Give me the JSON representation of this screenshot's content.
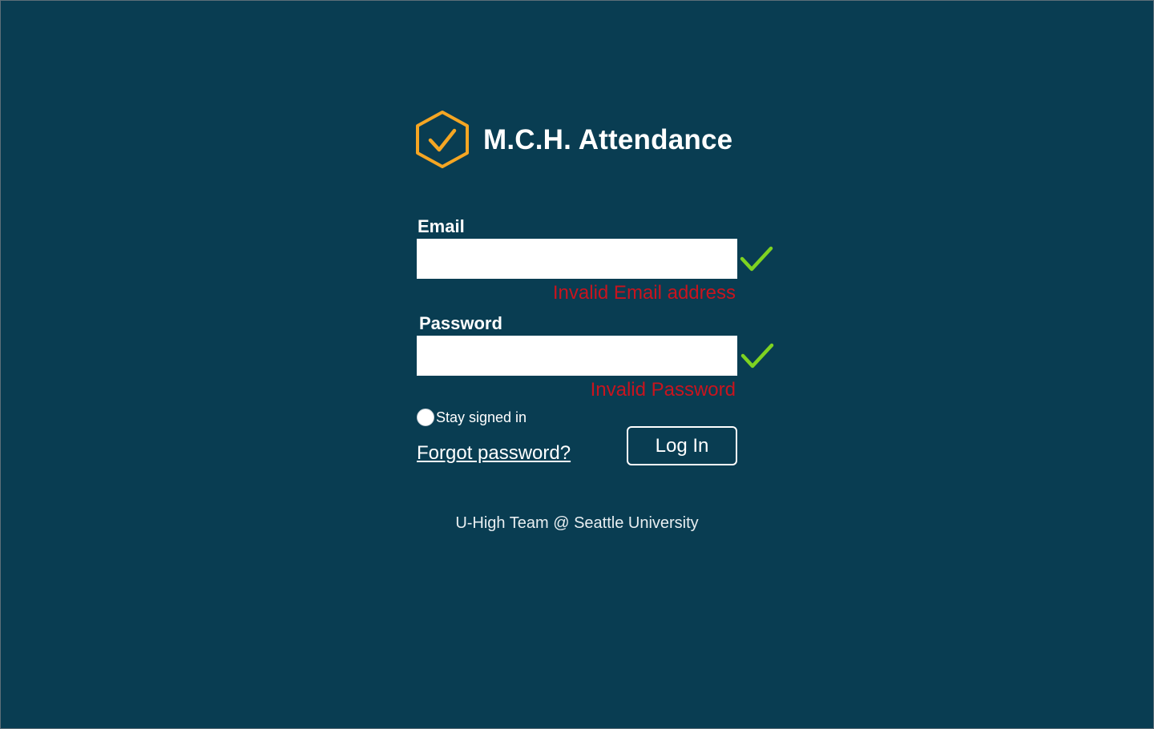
{
  "app": {
    "title": "M.C.H. Attendance",
    "logo_icon": "hexagon-check-icon"
  },
  "colors": {
    "background": "#093d52",
    "logo_orange": "#f5a623",
    "valid_green": "#7ed321",
    "error_red": "#c8141e"
  },
  "form": {
    "email_label": "Email",
    "email_value": "",
    "email_error": "Invalid Email address",
    "email_status_icon": "green-check-icon",
    "password_label": "Password",
    "password_value": "",
    "password_error": "Invalid Password",
    "password_status_icon": "green-check-icon",
    "stay_signed_in_label": "Stay signed in",
    "stay_signed_in_checked": false,
    "forgot_password_label": "Forgot password?",
    "login_button_label": "Log In"
  },
  "footer": {
    "text": "U-High Team @ Seattle University"
  }
}
